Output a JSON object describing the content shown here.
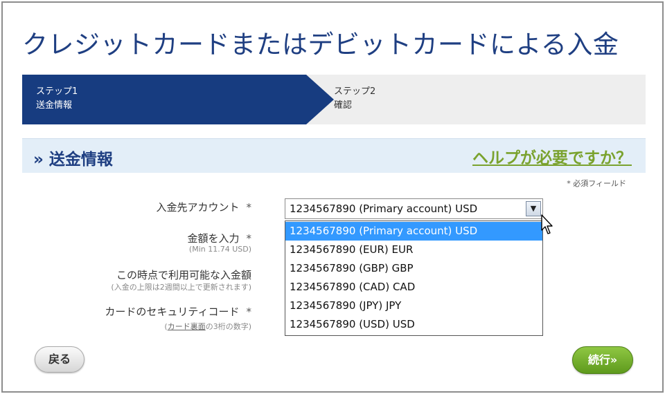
{
  "page": {
    "title": "クレジットカードまたはデビットカードによる入金"
  },
  "steps": [
    {
      "label": "ステップ1",
      "name": "送金情報",
      "active": true
    },
    {
      "label": "ステップ2",
      "name": "確認",
      "active": false
    }
  ],
  "section": {
    "title": "» 送金情報",
    "help_link": "ヘルプが必要ですか？"
  },
  "required_note": "* 必須フィールド",
  "form": {
    "account_label": "入金先アカウント",
    "amount_label": "金額を入力",
    "amount_hint": "(Min 11.74 USD)",
    "available_label": "この時点で利用可能な入金額",
    "available_hint": "(入金の上限は2週間以上で更新されます)",
    "security_code_label": "カードのセキュリティコード",
    "security_code_hint_prefix": "(",
    "security_code_hint_link": "カード裏面",
    "security_code_hint_suffix": "の3桁の数字)",
    "required_mark": "*"
  },
  "account_select": {
    "value": "1234567890 (Primary account) USD",
    "arrow": "▼",
    "options": [
      {
        "label": "1234567890 (Primary account) USD",
        "selected": true
      },
      {
        "label": "1234567890 (EUR) EUR",
        "selected": false
      },
      {
        "label": "1234567890 (GBP) GBP",
        "selected": false
      },
      {
        "label": "1234567890 (CAD) CAD",
        "selected": false
      },
      {
        "label": "1234567890 (JPY) JPY",
        "selected": false
      },
      {
        "label": "1234567890 (USD) USD",
        "selected": false
      }
    ]
  },
  "buttons": {
    "back": "戻る",
    "next": "続行»"
  },
  "colors": {
    "title": "#1f3f82",
    "step_active": "#173c80",
    "section_bg": "#e3eef8",
    "help_link": "#7aa22e",
    "selected_option": "#3399ff",
    "next_button": "#6aa82a"
  },
  "icons": {
    "dropdown_arrow": "chevron-down-icon",
    "mouse_cursor": "mouse-pointer-icon"
  }
}
